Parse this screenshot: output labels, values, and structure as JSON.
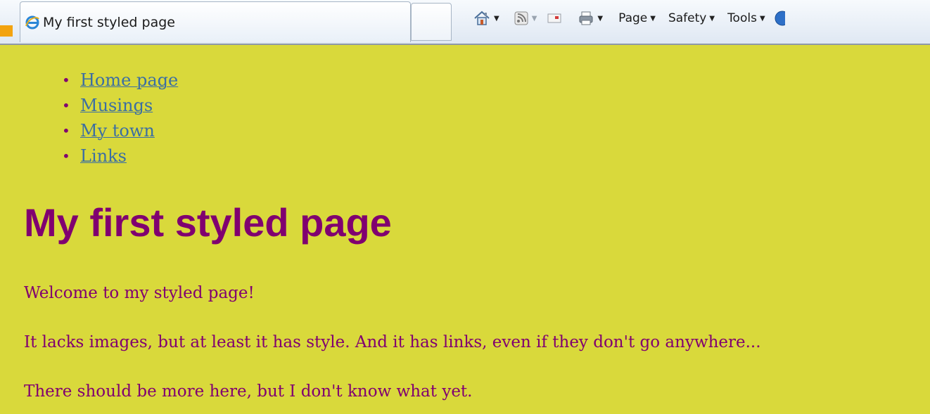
{
  "browser": {
    "tab_title": "My first styled page",
    "toolbar": {
      "page_label": "Page",
      "safety_label": "Safety",
      "tools_label": "Tools"
    }
  },
  "page": {
    "nav": [
      {
        "label": "Home page"
      },
      {
        "label": "Musings"
      },
      {
        "label": "My town"
      },
      {
        "label": "Links"
      }
    ],
    "heading": "My first styled page",
    "paragraphs": [
      "Welcome to my styled page!",
      "It lacks images, but at least it has style. And it has links, even if they don't go anywhere...",
      "There should be more here, but I don't know what yet."
    ]
  },
  "colors": {
    "page_background": "#d9d93b",
    "text": "#800070",
    "link": "#3b6ea3"
  },
  "icons": [
    "ie-logo-icon",
    "home-icon",
    "rss-feed-icon",
    "mail-icon",
    "printer-icon",
    "help-icon"
  ]
}
